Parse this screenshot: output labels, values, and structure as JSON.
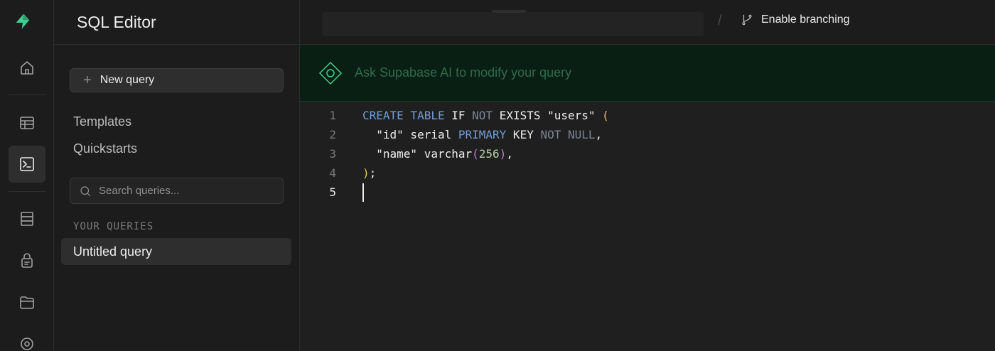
{
  "rail": {
    "items": [
      "home-icon",
      "table-editor-icon",
      "sql-editor-icon",
      "database-icon",
      "auth-icon",
      "storage-icon",
      "realtime-icon"
    ],
    "active": "sql-editor-icon",
    "brand_color": "#3ecf8e"
  },
  "sidebar": {
    "title": "SQL Editor",
    "new_query_label": "New query",
    "links": [
      "Templates",
      "Quickstarts"
    ],
    "search_placeholder": "Search queries...",
    "section_label": "YOUR QUERIES",
    "queries": [
      "Untitled query"
    ]
  },
  "topbar": {
    "branch_label": "Enable branching"
  },
  "ai": {
    "placeholder": "Ask Supabase AI to modify your query"
  },
  "editor": {
    "line_numbers": [
      "1",
      "2",
      "3",
      "4",
      "5"
    ],
    "current_line": 5,
    "lines": [
      "CREATE TABLE IF NOT EXISTS \"users\" (",
      "  \"id\" serial PRIMARY KEY NOT NULL,",
      "  \"name\" varchar(256),",
      ");",
      ""
    ]
  }
}
